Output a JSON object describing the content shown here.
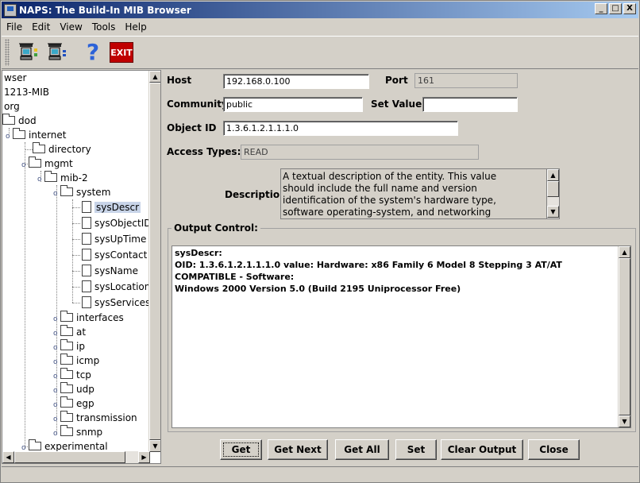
{
  "window": {
    "title": "NAPS:  The Build-In MIB Browser",
    "minimize": "_",
    "maximize": "□",
    "close": "X"
  },
  "menu": [
    {
      "label": "File"
    },
    {
      "label": "Edit"
    },
    {
      "label": "View"
    },
    {
      "label": "Tools"
    },
    {
      "label": "Help"
    }
  ],
  "toolbar": {
    "exit_label": "EXIT",
    "help_glyph": "?"
  },
  "tree": {
    "nodes": [
      {
        "label": "wser"
      },
      {
        "label": "1213-MIB"
      },
      {
        "label": "org"
      },
      {
        "label": "dod"
      },
      {
        "label": "internet"
      },
      {
        "label": "directory"
      },
      {
        "label": "mgmt"
      },
      {
        "label": "mib-2"
      },
      {
        "label": "system"
      },
      {
        "label": "sysDescr"
      },
      {
        "label": "sysObjectID"
      },
      {
        "label": "sysUpTime"
      },
      {
        "label": "sysContact"
      },
      {
        "label": "sysName"
      },
      {
        "label": "sysLocation"
      },
      {
        "label": "sysServices"
      },
      {
        "label": "interfaces"
      },
      {
        "label": "at"
      },
      {
        "label": "ip"
      },
      {
        "label": "icmp"
      },
      {
        "label": "tcp"
      },
      {
        "label": "udp"
      },
      {
        "label": "egp"
      },
      {
        "label": "transmission"
      },
      {
        "label": "snmp"
      },
      {
        "label": "experimental"
      }
    ]
  },
  "form": {
    "host_label": "Host",
    "host_value": "192.168.0.100",
    "port_label": "Port",
    "port_value": "161",
    "community_label": "Community",
    "community_value": "public",
    "setvalue_label": "Set Value",
    "setvalue_value": "",
    "oid_label": "Object ID",
    "oid_value": "1.3.6.1.2.1.1.1.0",
    "access_label": "Access Types:",
    "access_value": "READ",
    "description_label": "Description",
    "description_lines": [
      "A textual description of the entity.  This value",
      "should include the full name and version",
      "identification of the system's hardware type,",
      "software operating-system, and networking"
    ]
  },
  "output": {
    "title": "Output Control:",
    "lines": [
      "sysDescr:",
      "OID: 1.3.6.1.2.1.1.1.0  value: Hardware: x86 Family 6 Model 8 Stepping 3 AT/AT COMPATIBLE - Software:",
      "Windows 2000 Version 5.0 (Build 2195 Uniprocessor Free)"
    ]
  },
  "buttons": {
    "get": "Get",
    "get_next": "Get Next",
    "get_all": "Get All",
    "set": "Set",
    "clear_output": "Clear Output",
    "close": "Close"
  }
}
